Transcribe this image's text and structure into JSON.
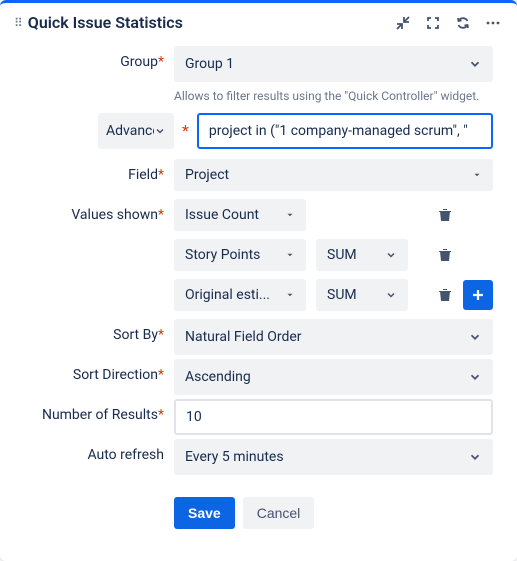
{
  "header": {
    "title": "Quick Issue Statistics"
  },
  "labels": {
    "group": "Group",
    "advanced": "Advanced",
    "field": "Field",
    "values_shown": "Values shown",
    "sort_by": "Sort By",
    "sort_direction": "Sort Direction",
    "number_of_results": "Number of Results",
    "auto_refresh": "Auto refresh"
  },
  "group": {
    "value": "Group 1",
    "helper": "Allows to filter results using the \"Quick Controller\" widget."
  },
  "jql": {
    "value": "project in (\"1 company-managed scrum\", \""
  },
  "field": {
    "value": "Project"
  },
  "values_shown": [
    {
      "field": "Issue Count",
      "agg": null
    },
    {
      "field": "Story Points",
      "agg": "SUM"
    },
    {
      "field": "Original esti...",
      "agg": "SUM"
    }
  ],
  "sort_by": {
    "value": "Natural Field Order"
  },
  "sort_direction": {
    "value": "Ascending"
  },
  "number_of_results": {
    "value": "10"
  },
  "auto_refresh": {
    "value": "Every 5 minutes"
  },
  "buttons": {
    "save": "Save",
    "cancel": "Cancel"
  },
  "colors": {
    "accent": "#0c66e4",
    "required": "#de350b"
  }
}
